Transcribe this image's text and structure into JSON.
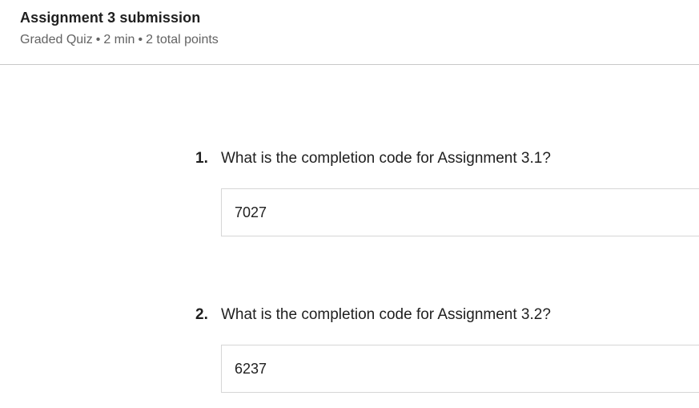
{
  "header": {
    "title": "Assignment 3 submission",
    "meta": {
      "type": "Graded Quiz",
      "separator": "•",
      "duration": "2 min",
      "points": "2 total points"
    }
  },
  "questions": [
    {
      "number": "1.",
      "text": "What is the completion code for Assignment 3.1?",
      "answer": "7027"
    },
    {
      "number": "2.",
      "text": "What is the completion code for Assignment 3.2?",
      "answer": "6237"
    }
  ]
}
